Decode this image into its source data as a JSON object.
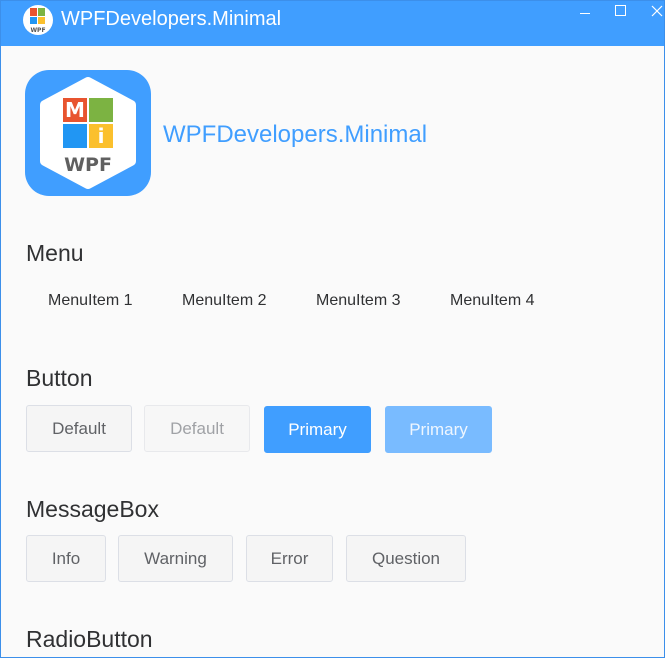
{
  "window": {
    "title": "WPFDevelopers.Minimal",
    "icon": "wpf-minimal-logo-icon",
    "controls": {
      "minimize": "minimize-icon",
      "maximize": "maximize-icon",
      "close": "close-icon"
    },
    "accent": "#409eff"
  },
  "header": {
    "logo": {
      "top_letters": [
        "M",
        "i"
      ],
      "bottom_text": "WPF"
    },
    "app_name": "WPFDevelopers.Minimal"
  },
  "sections": {
    "menu": {
      "title": "Menu",
      "items": [
        "MenuItem 1",
        "MenuItem 2",
        "MenuItem 3",
        "MenuItem 4"
      ]
    },
    "button": {
      "title": "Button",
      "buttons": [
        {
          "label": "Default",
          "style": "default",
          "enabled": true
        },
        {
          "label": "Default",
          "style": "default",
          "enabled": false
        },
        {
          "label": "Primary",
          "style": "primary",
          "enabled": true
        },
        {
          "label": "Primary",
          "style": "primary",
          "enabled": false
        }
      ]
    },
    "messagebox": {
      "title": "MessageBox",
      "buttons": [
        "Info",
        "Warning",
        "Error",
        "Question"
      ]
    },
    "radiobutton": {
      "title": "RadioButton"
    }
  },
  "colors": {
    "primary": "#409eff",
    "primary_disabled": "#79bbff",
    "text": "#303133",
    "border": "#dcdfe6"
  }
}
